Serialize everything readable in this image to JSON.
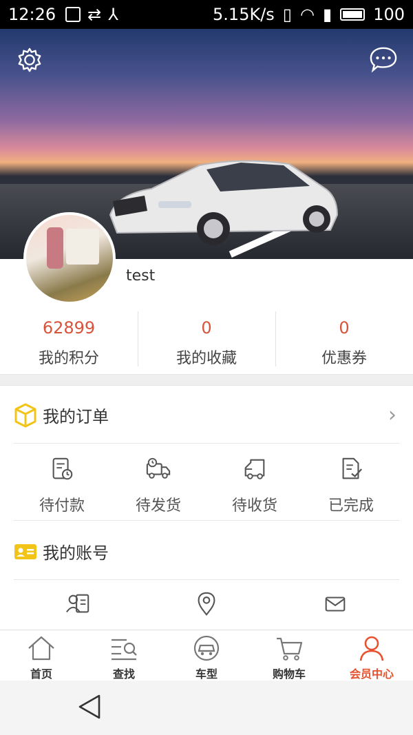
{
  "status_bar": {
    "time": "12:26",
    "speed": "5.15K/s",
    "battery": "100"
  },
  "profile": {
    "username": "test"
  },
  "stats": [
    {
      "value": "62899",
      "label": "我的积分"
    },
    {
      "value": "0",
      "label": "我的收藏"
    },
    {
      "value": "0",
      "label": "优惠券"
    }
  ],
  "orders": {
    "title": "我的订单",
    "items": [
      {
        "label": "待付款",
        "icon": "pending-payment-icon"
      },
      {
        "label": "待发货",
        "icon": "truck-clock-icon"
      },
      {
        "label": "待收货",
        "icon": "truck-receive-icon"
      },
      {
        "label": "已完成",
        "icon": "doc-check-icon"
      }
    ]
  },
  "account": {
    "title": "我的账号",
    "items": [
      {
        "icon": "profile-card-icon"
      },
      {
        "icon": "location-pin-icon"
      },
      {
        "icon": "mail-icon"
      }
    ]
  },
  "tabbar": {
    "items": [
      {
        "label": "首页",
        "icon": "home-icon"
      },
      {
        "label": "查找",
        "icon": "search-list-icon"
      },
      {
        "label": "车型",
        "icon": "car-icon"
      },
      {
        "label": "购物车",
        "icon": "cart-icon"
      },
      {
        "label": "会员中心",
        "icon": "member-icon",
        "active": true
      }
    ]
  },
  "colors": {
    "accent": "#e8502d",
    "points": "#d9533a",
    "section_icon": "#f2c418"
  }
}
